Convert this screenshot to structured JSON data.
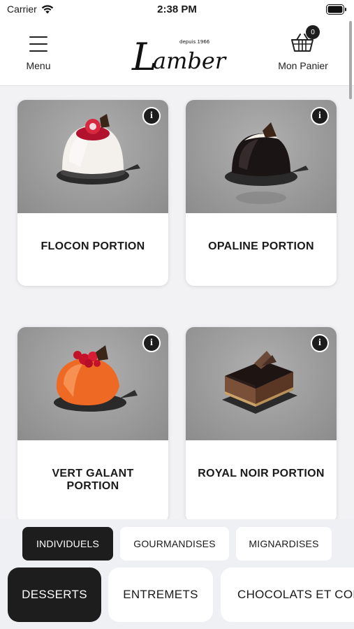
{
  "status_bar": {
    "carrier": "Carrier",
    "time": "2:38 PM"
  },
  "header": {
    "menu_label": "Menu",
    "brand": "Lambert",
    "brand_tagline": "depuis 1966",
    "cart_label": "Mon Panier",
    "cart_count": "0"
  },
  "products": [
    {
      "name": "FLOCON PORTION",
      "icon": "info-icon"
    },
    {
      "name": "OPALINE PORTION",
      "icon": "info-icon"
    },
    {
      "name": "VERT GALANT PORTION",
      "icon": "info-icon"
    },
    {
      "name": "ROYAL NOIR PORTION",
      "icon": "info-icon"
    }
  ],
  "subcategories": [
    {
      "label": "INDIVIDUELS",
      "active": true
    },
    {
      "label": "GOURMANDISES",
      "active": false
    },
    {
      "label": "MIGNARDISES",
      "active": false
    }
  ],
  "categories": [
    {
      "label": "DESSERTS",
      "active": true
    },
    {
      "label": "ENTREMETS",
      "active": false
    },
    {
      "label": "CHOCOLATS ET CONFISERIES",
      "active": false
    }
  ],
  "colors": {
    "dark": "#1d1d1d",
    "background": "#f2f2f4",
    "card": "#ffffff"
  }
}
